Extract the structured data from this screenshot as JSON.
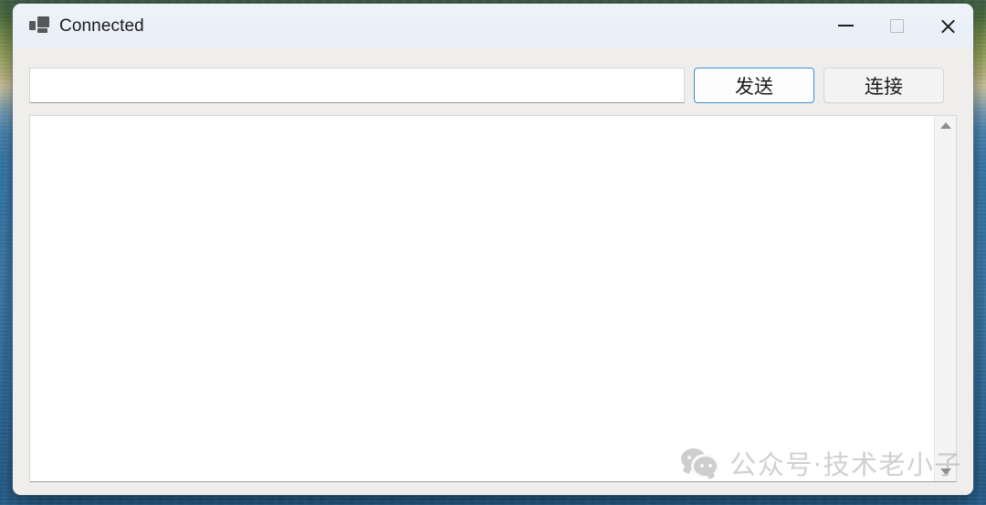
{
  "desktop": {
    "wallpaper_name": "coastal-beach-wallpaper",
    "colors": {
      "vegetation": "#4a6b3e",
      "sand": "#d8cfa8",
      "water": "#3a7fb5",
      "deep_water": "#27608f"
    }
  },
  "window": {
    "title": "Connected",
    "icon": "network-computers-icon",
    "colors": {
      "titlebar": "#eaf0f7",
      "client": "#efeeed",
      "accent_focus": "#3a8ed0"
    },
    "controls": {
      "minimize_label": "Minimize",
      "minimize_glyph": "—",
      "maximize_label": "Maximize",
      "maximize_glyph": "□",
      "close_label": "Close",
      "close_glyph": "✕"
    }
  },
  "toolbar": {
    "message_input": {
      "value": "",
      "placeholder": ""
    },
    "send_label": "发送",
    "connect_label": "连接"
  },
  "log": {
    "content": "",
    "scrollbar": {
      "up_arrow": "scroll-up-arrow",
      "down_arrow": "scroll-down-arrow"
    }
  },
  "watermark": {
    "logo": "wechat-logo",
    "text": "公众号·技术老小子"
  }
}
